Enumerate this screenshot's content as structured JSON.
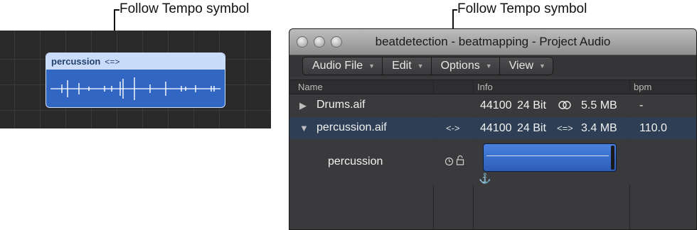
{
  "callouts": {
    "left": "Follow Tempo symbol",
    "right": "Follow Tempo symbol"
  },
  "tracks_region": {
    "name": "percussion",
    "follow_tempo_symbol": "<=>"
  },
  "window": {
    "title": "beatdetection - beatmapping - Project Audio",
    "menus": [
      "Audio File",
      "Edit",
      "Options",
      "View"
    ],
    "columns": {
      "name": "Name",
      "info": "Info",
      "bpm": "bpm"
    },
    "rows": [
      {
        "name": "Drums.aif",
        "disclosure": "▶",
        "sample_rate": "44100",
        "bit_depth": "24 Bit",
        "stereo_icon": "stereo-icon",
        "size": "5.5 MB",
        "bpm": "-"
      },
      {
        "name": "percussion.aif",
        "disclosure": "▼",
        "follow_tempo": "<->",
        "sample_rate": "44100",
        "bit_depth": "24 Bit",
        "follow_icon": "<=>",
        "size": "3.4 MB",
        "bpm": "110.0"
      },
      {
        "name": "percussion",
        "status_icons": [
          "clock-icon",
          "lock-icon"
        ],
        "anchor": "⚓"
      }
    ],
    "colors": {
      "selected_row": "#2d3e55",
      "clip_blue": "#3a72d4"
    }
  }
}
